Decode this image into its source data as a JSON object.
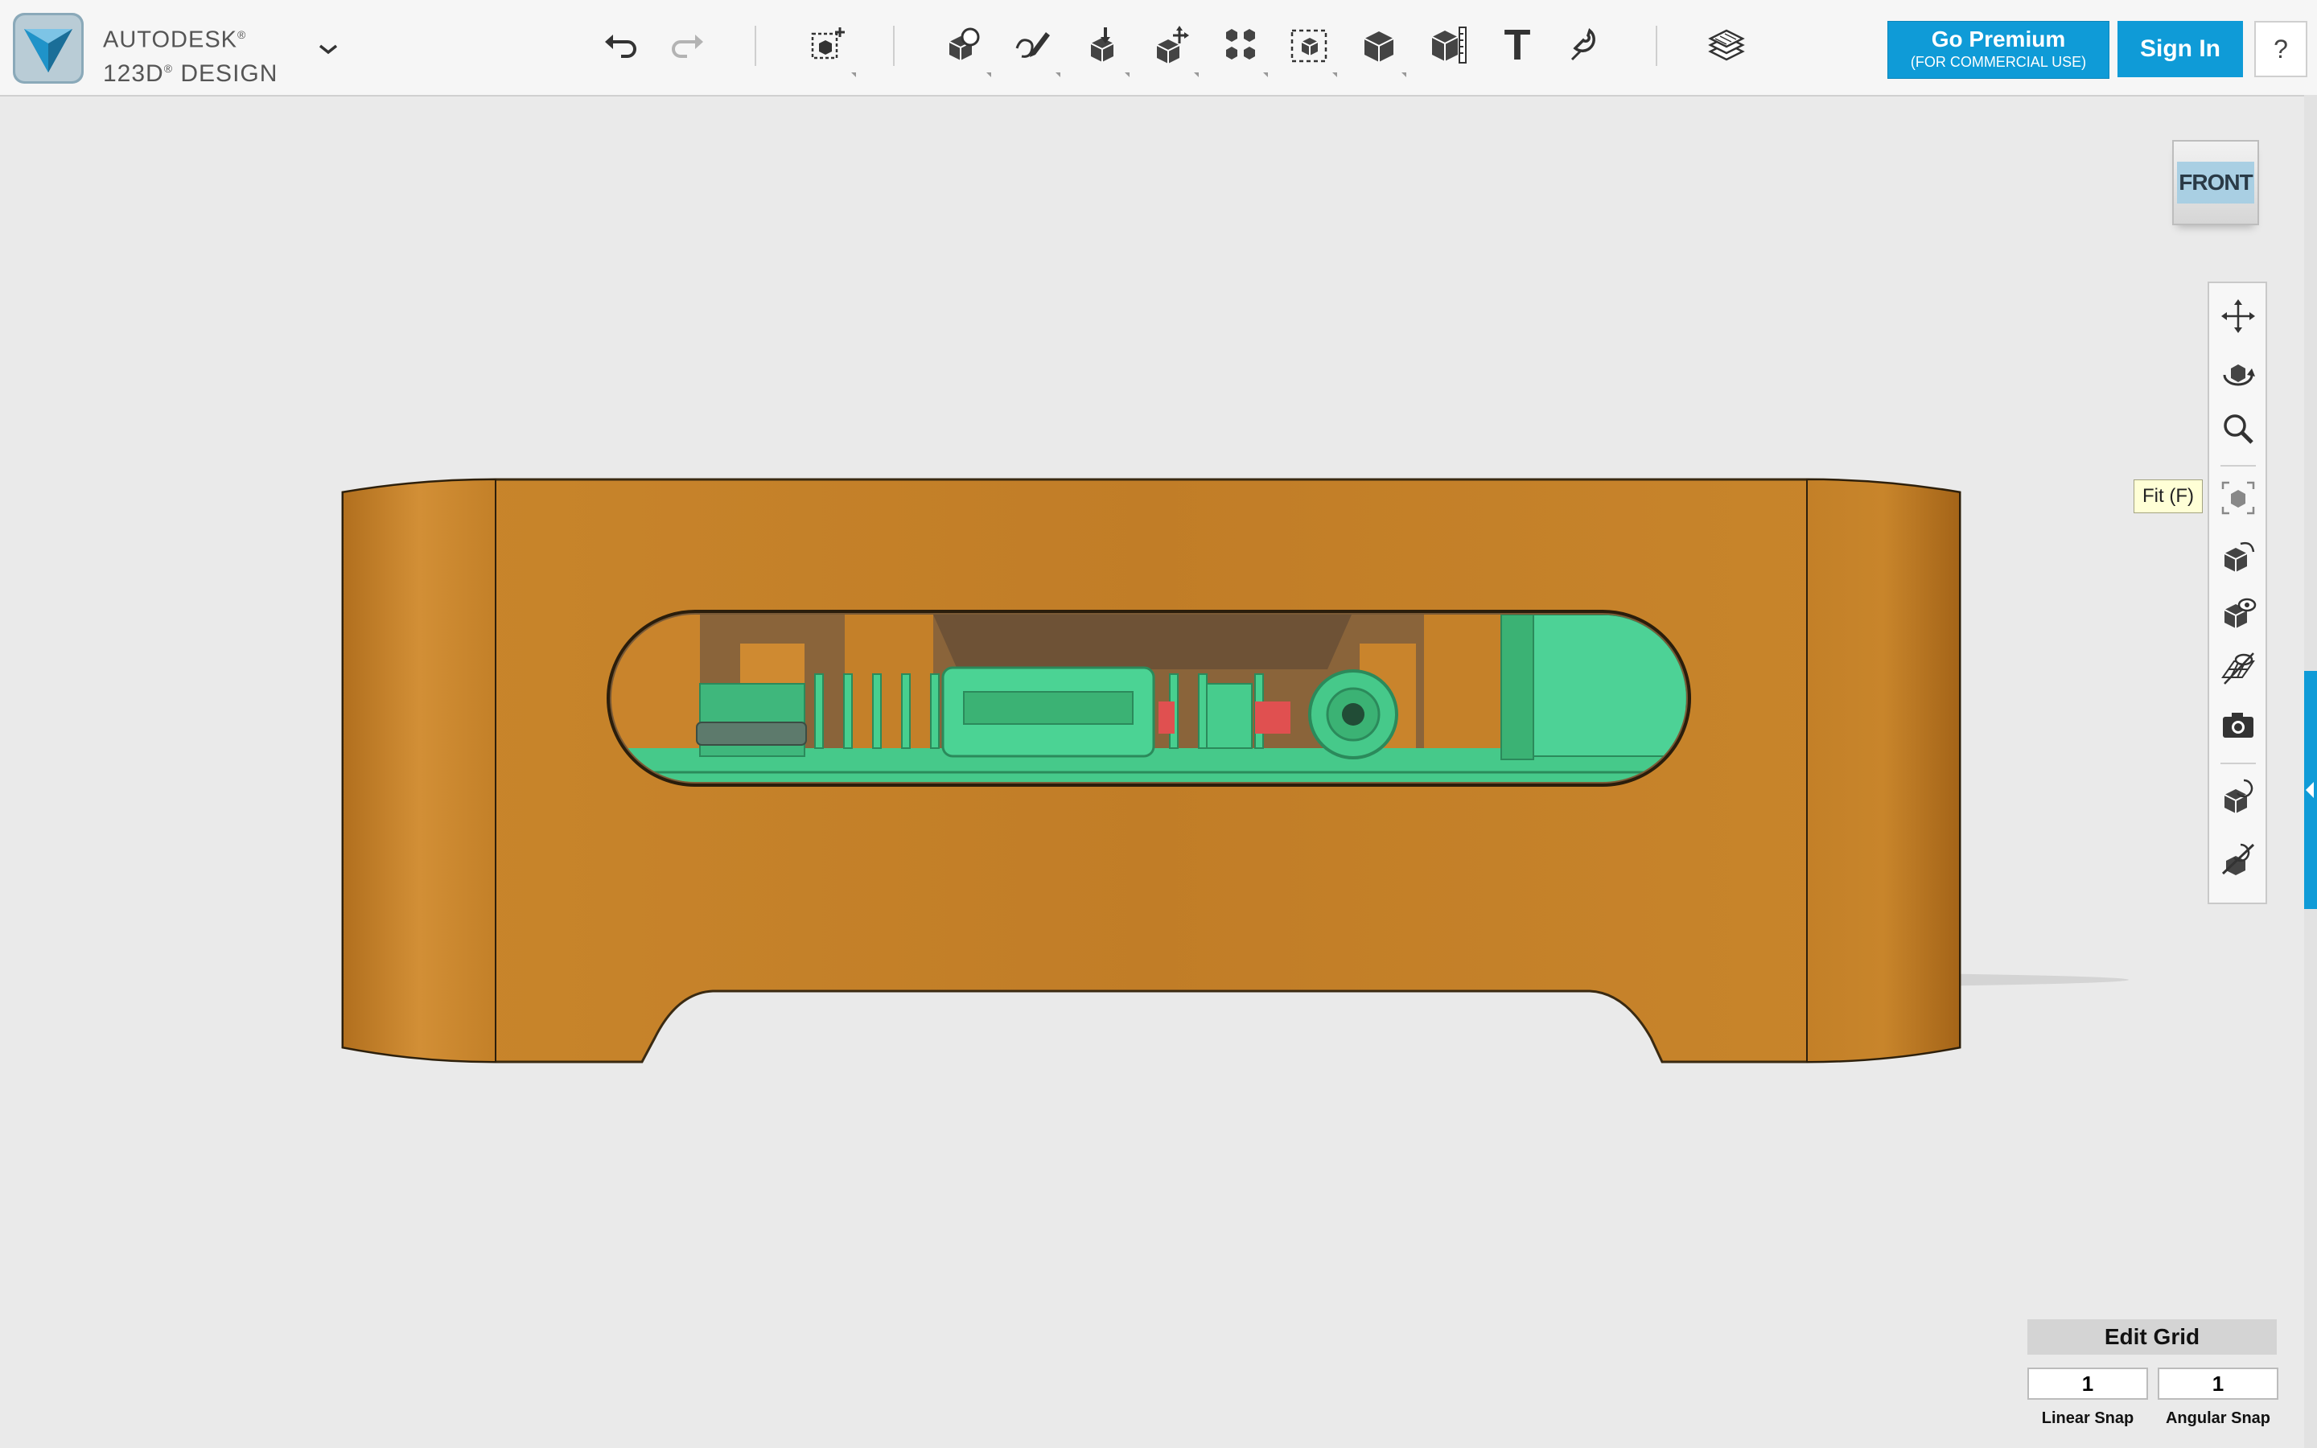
{
  "app": {
    "brand_line1": "AUTODESK",
    "brand_line2": "123D",
    "brand_line2_suffix": " DESIGN",
    "registered_mark": "®"
  },
  "toolbar": {
    "icons": [
      "undo-icon",
      "redo-icon",
      "new-primitive-icon",
      "primitives-icon",
      "sketch-icon",
      "construct-icon",
      "modify-icon",
      "pattern-icon",
      "group-icon",
      "combine-icon",
      "measure-icon",
      "text-icon",
      "snap-icon",
      "materials-icon"
    ],
    "text_tool_glyph": "T"
  },
  "premium": {
    "title": "Go Premium",
    "subtitle": "(FOR COMMERCIAL USE)"
  },
  "signin_label": "Sign In",
  "help_label": "?",
  "viewcube_label": "FRONT",
  "navbar": {
    "items": [
      "pan-icon",
      "orbit-icon",
      "zoom-icon",
      "fit-icon",
      "perspective-icon",
      "visibility-icon",
      "grid-visibility-icon",
      "screenshot-icon",
      "material-snap-icon",
      "hide-icon"
    ],
    "tooltip": "Fit (F)"
  },
  "grid": {
    "edit_label": "Edit Grid",
    "linear_snap_value": "1",
    "angular_snap_value": "1",
    "linear_snap_label": "Linear Snap",
    "angular_snap_label": "Angular Snap"
  },
  "colors": {
    "accent": "#0f9bd7",
    "case_orange": "#c17d27",
    "pcb_green": "#46c98a",
    "background": "#eaeaea"
  }
}
